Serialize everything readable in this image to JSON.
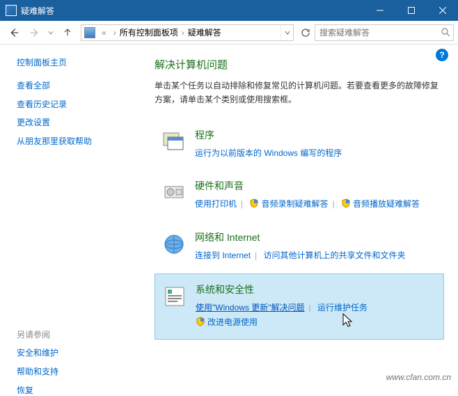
{
  "titlebar": {
    "title": "疑难解答"
  },
  "breadcrumb": {
    "item1": "所有控制面板项",
    "item2": "疑难解答"
  },
  "search": {
    "placeholder": "搜索疑难解答"
  },
  "sidebar": {
    "home": "控制面板主页",
    "links": [
      "查看全部",
      "查看历史记录",
      "更改设置",
      "从朋友那里获取帮助"
    ],
    "see_also_label": "另请参阅",
    "see_also": [
      "安全和维护",
      "帮助和支持",
      "恢复"
    ]
  },
  "main": {
    "heading": "解决计算机问题",
    "desc": "单击某个任务以自动排除和修复常见的计算机问题。若要查看更多的故障修复方案，请单击某个类别或使用搜索框。",
    "cat1": {
      "title": "程序",
      "link1": "运行为以前版本的 Windows 编写的程序"
    },
    "cat2": {
      "title": "硬件和声音",
      "link1": "使用打印机",
      "link2": "音频录制疑难解答",
      "link3": "音频播放疑难解答"
    },
    "cat3": {
      "title": "网络和 Internet",
      "link1": "连接到 Internet",
      "link2": "访问其他计算机上的共享文件和文件夹"
    },
    "cat4": {
      "title": "系统和安全性",
      "link1": "使用\"Windows 更新\"解决问题",
      "link2": "运行维护任务",
      "link3": "改进电源使用"
    }
  },
  "watermark": "www.cfan.com.cn"
}
